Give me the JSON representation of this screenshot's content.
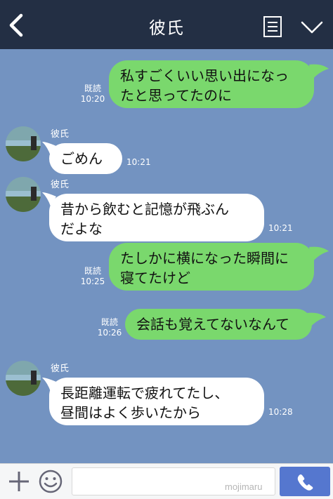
{
  "header": {
    "title": "彼氏",
    "back_icon": "chevron-left-icon",
    "menu_icon": "notes-menu-icon",
    "collapse_icon": "chevron-down-icon"
  },
  "messages": [
    {
      "side": "mine",
      "text": "私すごくいい思い出になったと思ってたのに",
      "line1": "私すごくいい思い出になっ",
      "line2": "たと思ってたのに",
      "read": "既読",
      "time": "10:20"
    },
    {
      "side": "theirs",
      "sender": "彼氏",
      "text": "ごめん",
      "time": "10:21"
    },
    {
      "side": "theirs",
      "sender": "彼氏",
      "text": "昔から飲むと記憶が飛ぶんだよな",
      "line1": "昔から飲むと記憶が飛ぶん",
      "line2": "だよな",
      "time": "10:21"
    },
    {
      "side": "mine",
      "text": "たしかに横になった瞬間に寝てたけど",
      "line1": "たしかに横になった瞬間に",
      "line2": "寝てたけど",
      "read": "既読",
      "time": "10:25"
    },
    {
      "side": "mine",
      "text": "会話も覚えてないなんて",
      "read": "既読",
      "time": "10:26"
    },
    {
      "side": "theirs",
      "sender": "彼氏",
      "text": "長距離運転で疲れてたし、昼間はよく歩いたから",
      "line1": "長距離運転で疲れてたし、",
      "line2": "昼間はよく歩いたから",
      "time": "10:28"
    }
  ],
  "footer": {
    "plus_icon": "plus-icon",
    "emoji_icon": "smiley-icon",
    "input_placeholder": "",
    "watermark": "mojimaru",
    "call_icon": "phone-icon"
  },
  "colors": {
    "header_bg": "#232f44",
    "chat_bg": "#7393c1",
    "my_bubble": "#7ad86d",
    "their_bubble": "#ffffff",
    "call_button": "#5577cf"
  }
}
